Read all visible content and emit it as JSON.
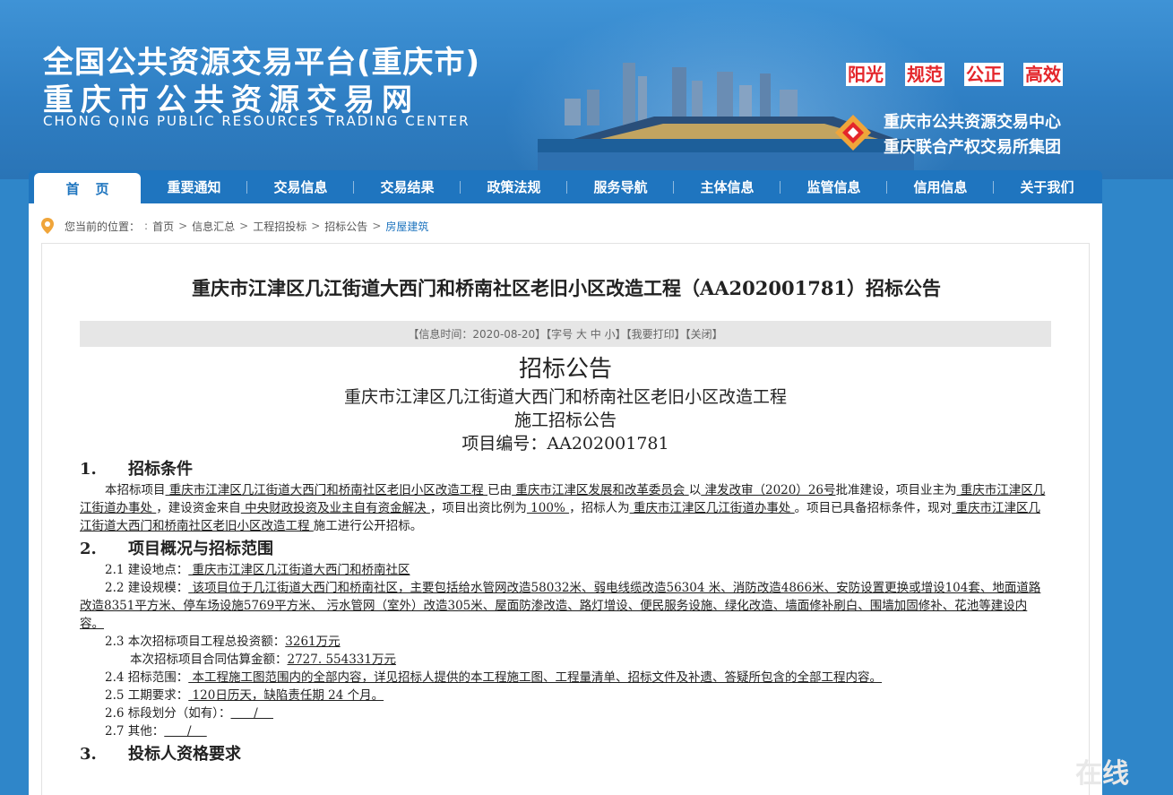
{
  "header": {
    "title_line1": "全国公共资源交易平台(重庆市)",
    "title_line2": "重庆市公共资源交易网",
    "title_en": "CHONG QING PUBLIC RESOURCES TRADING CENTER",
    "slogans": [
      "阳光",
      "规范",
      "公正",
      "高效"
    ],
    "org_line1": "重庆市公共资源交易中心",
    "org_line2": "重庆联合产权交易所集团"
  },
  "nav": [
    "首页",
    "重要通知",
    "交易信息",
    "交易结果",
    "政策法规",
    "服务导航",
    "主体信息",
    "监管信息",
    "信用信息",
    "关于我们"
  ],
  "breadcrumb": {
    "prefix": "您当前的位置：",
    "items": [
      "首页",
      "信息汇总",
      "工程招投标",
      "招标公告",
      "房屋建筑"
    ]
  },
  "announcement": {
    "title": "重庆市江津区几江街道大西门和桥南社区老旧小区改造工程（AA202001781）招标公告",
    "info_bar": "【信息时间：2020-08-20】【字号 大 中 小】【我要打印】【关闭】"
  },
  "doc": {
    "heading": "招标公告",
    "sub1": "重庆市江津区几江街道大西门和桥南社区老旧小区改造工程",
    "sub2": "施工招标公告",
    "sub3": "项目编号：AA202001781",
    "sec1_num": "1.",
    "sec1_title": "招标条件",
    "sec1_p1a": "本招标项目",
    "sec1_p1b": "  重庆市江津区几江街道大西门和桥南社区老旧小区改造工程  ",
    "sec1_p1c": "已由",
    "sec1_p1d": "  重庆市江津区发展和改革委员会  ",
    "sec1_p1e": "以",
    "sec1_p1f": "  津发改审（2020）26号",
    "sec1_p1g": "批准建设，项目业主为",
    "sec1_p1h": "  重庆市江津区几江街道办事处  ",
    "sec1_p1i": "，建设资金来自",
    "sec1_p1j": "  中央财政投资及业主自有资金解决  ",
    "sec1_p1k": "，项目出资比例为",
    "sec1_p1l": "  100%  ",
    "sec1_p1m": "，招标人为",
    "sec1_p1n": "  重庆市江津区几江街道办事处  ",
    "sec1_p1o": "。项目已具备招标条件，现对",
    "sec1_p1p": "  重庆市江津区几江街道大西门和桥南社区老旧小区改造工程  ",
    "sec1_p1q": "施工进行公开招标。",
    "sec2_num": "2.",
    "sec2_title": "项目概况与招标范围",
    "l21a": "2.1 建设地点：",
    "l21b": "  重庆市江津区几江街道大西门和桥南社区  ",
    "l22a": "2.2 建设规模：",
    "l22b": "  该项目位于几江街道大西门和桥南社区，主要包括给水管网改造58032米、弱电线缆改造56304 米、消防改造4866米、安防设置更换或增设104套、地面道路改造8351平方米、停车场设施5769平方米、 污水管网（室外）改造305米、屋面防渗改造、路灯增设、便民服务设施、绿化改造、墙面修补刷白、围墙加固修补、花池等建设内容。  ",
    "l23a": "2.3 本次招标项目工程总投资额：",
    "l23b": "3261万元",
    "l23c": "本次招标项目合同估算金额：",
    "l23d": "2727. 554331万元",
    "l24a": "2.4 招标范围：",
    "l24b": "  本工程施工图范围内的全部内容，详见招标人提供的本工程施工图、工程量清单、招标文件及补遗、答疑所包含的全部工程内容。",
    "l25a": "2.5 工期要求：",
    "l25b": "  120日历天，缺陷责任期 24 个月。",
    "l26a": "2.6 标段划分（如有）：",
    "l26b": "      /    ",
    "l27a": "2.7 其他：",
    "l27b": "      /    ",
    "sec3_num": "3.",
    "sec3_title": "投标人资格要求"
  },
  "watermark": "在线"
}
